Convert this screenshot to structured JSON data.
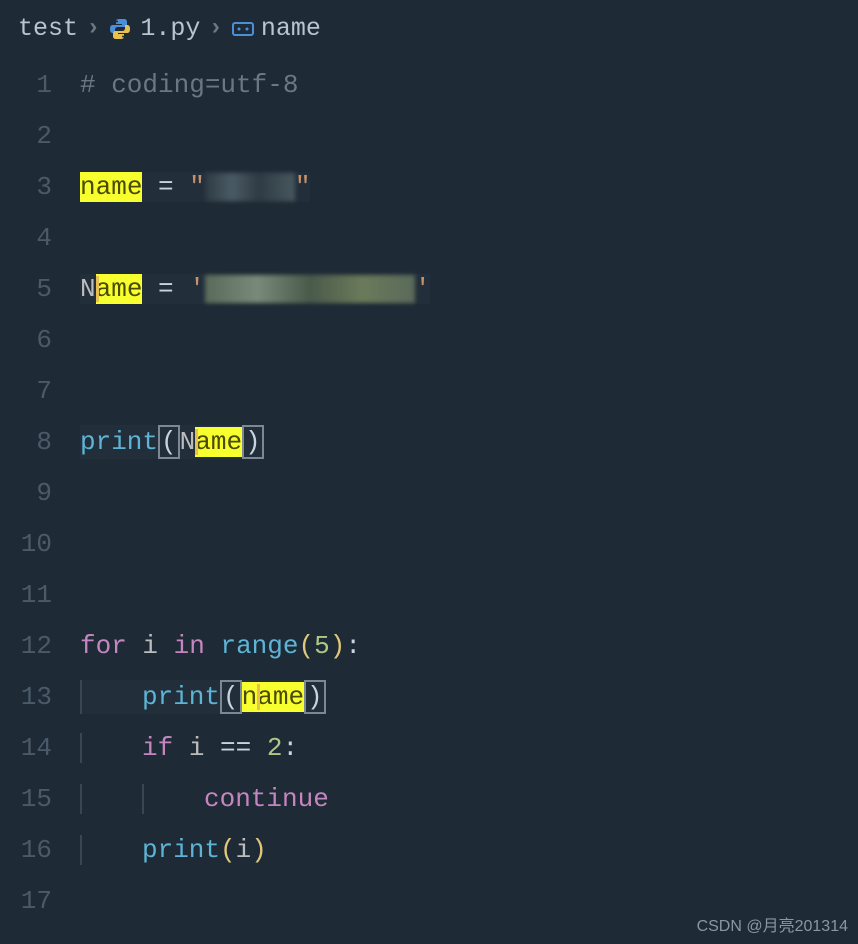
{
  "breadcrumb": {
    "folder": "test",
    "file": "1.py",
    "symbol": "name"
  },
  "code": {
    "line_count": 17,
    "comment_line1": "# coding=utf-8",
    "name_var": "name",
    "name_assign_op": " = ",
    "name_str_open": "\"",
    "name_str_close": "\"",
    "Name_var": "Name",
    "Name_assign_op": " = ",
    "Name_str_open": "'",
    "Name_str_close": "'",
    "print_fn": "print",
    "for_kw": "for",
    "loop_var": "i",
    "in_kw": "in",
    "range_fn": "range",
    "range_arg": "5",
    "colon": ":",
    "if_kw": "if",
    "eq_op": "==",
    "cmp_val": "2",
    "continue_kw": "continue",
    "highlight_term": "name",
    "match_n": "n",
    "match_ame": "ame",
    "N_char": "N"
  },
  "watermark": "CSDN @月亮201314"
}
